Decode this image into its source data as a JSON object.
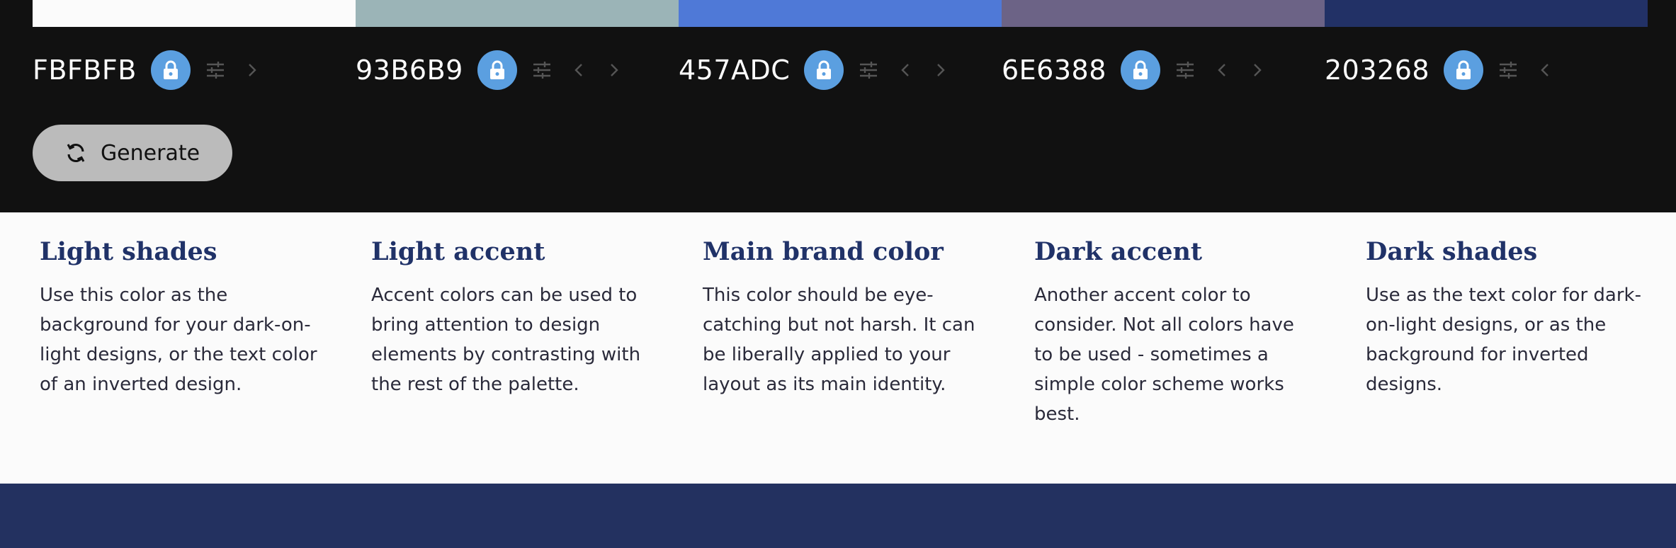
{
  "palette": [
    {
      "hex": "FBFBFB",
      "color": "#fbfbfb",
      "has_prev": false,
      "has_next": true
    },
    {
      "hex": "93B6B9",
      "color": "#9bb4b7",
      "has_prev": true,
      "has_next": true
    },
    {
      "hex": "457ADC",
      "color": "#4f79d7",
      "has_prev": true,
      "has_next": true
    },
    {
      "hex": "6E6388",
      "color": "#6c6386",
      "has_prev": true,
      "has_next": true
    },
    {
      "hex": "203268",
      "color": "#223166",
      "has_prev": true,
      "has_next": false
    }
  ],
  "generate": {
    "label": "Generate"
  },
  "info": [
    {
      "title": "Light shades",
      "text": "Use this color as the background for your dark-on-light designs, or the text color of an inverted design."
    },
    {
      "title": "Light accent",
      "text": "Accent colors can be used to bring attention to design elements by contrasting with the rest of the palette."
    },
    {
      "title": "Main brand color",
      "text": "This color should be eye-catching but not harsh. It can be liberally applied to your layout as its main identity."
    },
    {
      "title": "Dark accent",
      "text": "Another accent color to consider. Not all colors have to be used - sometimes a simple color scheme works best."
    },
    {
      "title": "Dark shades",
      "text": "Use as the text color for dark-on-light designs, or as the background for inverted designs."
    }
  ],
  "colors": {
    "lock_bg": "#5b9fe0",
    "heading": "#203268",
    "footer": "#233160",
    "dark_bg": "#111111"
  },
  "icons": {
    "lock": "lock-icon",
    "adjust": "sliders-icon",
    "prev": "chevron-left-icon",
    "next": "chevron-right-icon",
    "refresh": "refresh-icon"
  }
}
